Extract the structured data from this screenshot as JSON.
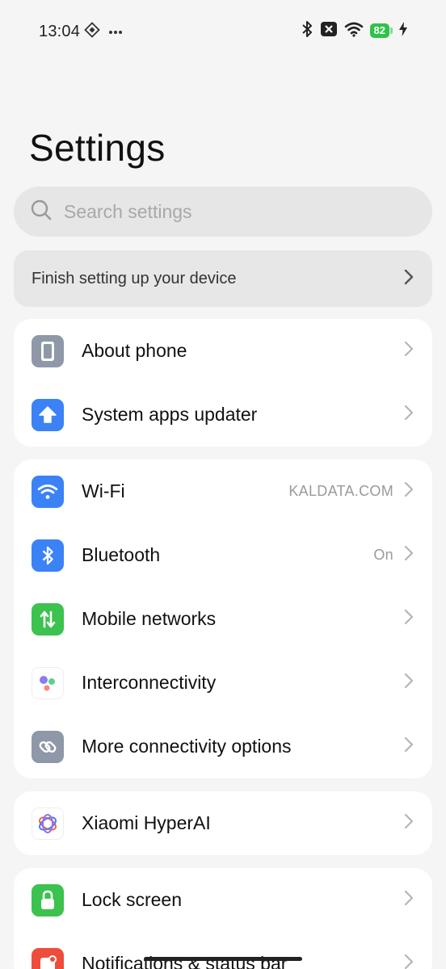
{
  "status_bar": {
    "time": "13:04",
    "battery_level": "82",
    "icons": [
      "diamond-grid-icon",
      "more-dots-icon",
      "bluetooth-icon",
      "sim-x-icon",
      "wifi-icon",
      "battery-icon",
      "charging-bolt-icon"
    ]
  },
  "page": {
    "title": "Settings"
  },
  "search": {
    "placeholder": "Search settings"
  },
  "setup": {
    "label": "Finish setting up your device"
  },
  "groups": [
    {
      "items": [
        {
          "label": "About phone",
          "value": "",
          "icon": "phone-icon",
          "color": "#8e98a8"
        },
        {
          "label": "System apps updater",
          "value": "",
          "icon": "upload-arrow-icon",
          "color": "#3b82f6"
        }
      ]
    },
    {
      "items": [
        {
          "label": "Wi-Fi",
          "value": "KALDATA.COM",
          "icon": "wifi-icon",
          "color": "#3b82f6"
        },
        {
          "label": "Bluetooth",
          "value": "On",
          "icon": "bluetooth-icon",
          "color": "#3b82f6"
        },
        {
          "label": "Mobile networks",
          "value": "",
          "icon": "mobile-data-arrows-icon",
          "color": "#3cc24e"
        },
        {
          "label": "Interconnectivity",
          "value": "",
          "icon": "interconnectivity-dots-icon",
          "color": "#ffffff"
        },
        {
          "label": "More connectivity options",
          "value": "",
          "icon": "link-icon",
          "color": "#8e98a8"
        }
      ]
    },
    {
      "items": [
        {
          "label": "Xiaomi HyperAI",
          "value": "",
          "icon": "hyperai-swirl-icon",
          "color": "#ffffff"
        }
      ]
    },
    {
      "items": [
        {
          "label": "Lock screen",
          "value": "",
          "icon": "lock-icon",
          "color": "#3cc24e"
        },
        {
          "label": "Notifications & status bar",
          "value": "",
          "icon": "notification-icon",
          "color": "#ef4d3c"
        }
      ]
    }
  ]
}
